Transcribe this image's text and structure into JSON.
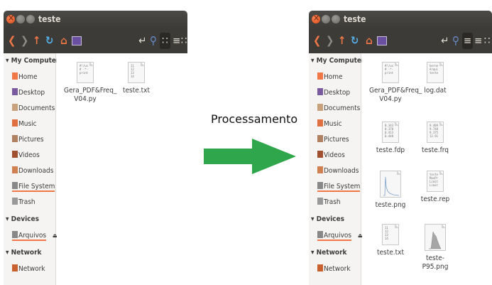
{
  "window_title": "teste",
  "toolbar_icons": [
    "back-icon",
    "forward-icon",
    "up-arrow-icon",
    "reload-icon",
    "home-icon",
    "terminal-icon",
    "return-icon",
    "search-icon",
    "grid-view-icon",
    "list-view-icon",
    "columns-icon"
  ],
  "sidebar": {
    "sections": [
      {
        "title": "My Computer",
        "items": [
          {
            "label": "Home",
            "icon": "home-folder-icon",
            "color": "#f07746"
          },
          {
            "label": "Desktop",
            "icon": "desktop-folder-icon",
            "color": "#7a5a9e"
          },
          {
            "label": "Documents",
            "icon": "documents-folder-icon",
            "color": "#c8a27a"
          },
          {
            "label": "Music",
            "icon": "music-folder-icon",
            "color": "#e07040"
          },
          {
            "label": "Pictures",
            "icon": "pictures-folder-icon",
            "color": "#b08060"
          },
          {
            "label": "Videos",
            "icon": "videos-folder-icon",
            "color": "#a05030"
          },
          {
            "label": "Downloads",
            "icon": "downloads-folder-icon",
            "color": "#d08050"
          },
          {
            "label": "File System",
            "icon": "drive-icon",
            "color": "#888888"
          },
          {
            "label": "Trash",
            "icon": "trash-icon",
            "color": "#999999"
          }
        ]
      },
      {
        "title": "Devices",
        "items": [
          {
            "label": "Arquivos",
            "icon": "drive-icon",
            "color": "#888888"
          }
        ]
      },
      {
        "title": "Network",
        "items": [
          {
            "label": "Network",
            "icon": "network-icon",
            "color": "#c86030"
          }
        ]
      }
    ]
  },
  "left_files": [
    {
      "name": "Gera_PDF&Freq_\nV04.py",
      "preview": [
        "#!/us",
        "# -*-",
        "",
        "",
        "print"
      ]
    },
    {
      "name": "teste.txt",
      "preview": [
        "11",
        "12",
        "13",
        "14"
      ]
    }
  ],
  "right_files": [
    {
      "name": "Gera_PDF&Freq_\nV04.py",
      "preview": [
        "#!/us",
        "# -*-",
        "",
        "",
        "print"
      ]
    },
    {
      "name": "log.dat",
      "preview": [
        "kerne",
        "Arqui",
        "teste"
      ]
    },
    {
      "name": "teste.fdp",
      "preview": [
        "0.343",
        "0.378",
        "0.413",
        "0.448"
      ]
    },
    {
      "name": "teste.frq",
      "preview": [
        "9.409",
        "9.748",
        "9.375",
        "12.91"
      ]
    },
    {
      "name": "teste.png",
      "preview": []
    },
    {
      "name": "teste.rep",
      "preview": [
        "teste",
        "MaxPr",
        "Limit",
        "Limit"
      ]
    },
    {
      "name": "teste.txt",
      "preview": [
        "11",
        "12",
        "13",
        "14"
      ]
    },
    {
      "name": "teste-P95.png",
      "preview": []
    }
  ],
  "process_label": "Processamento",
  "arrow_color": "#2fa64b"
}
